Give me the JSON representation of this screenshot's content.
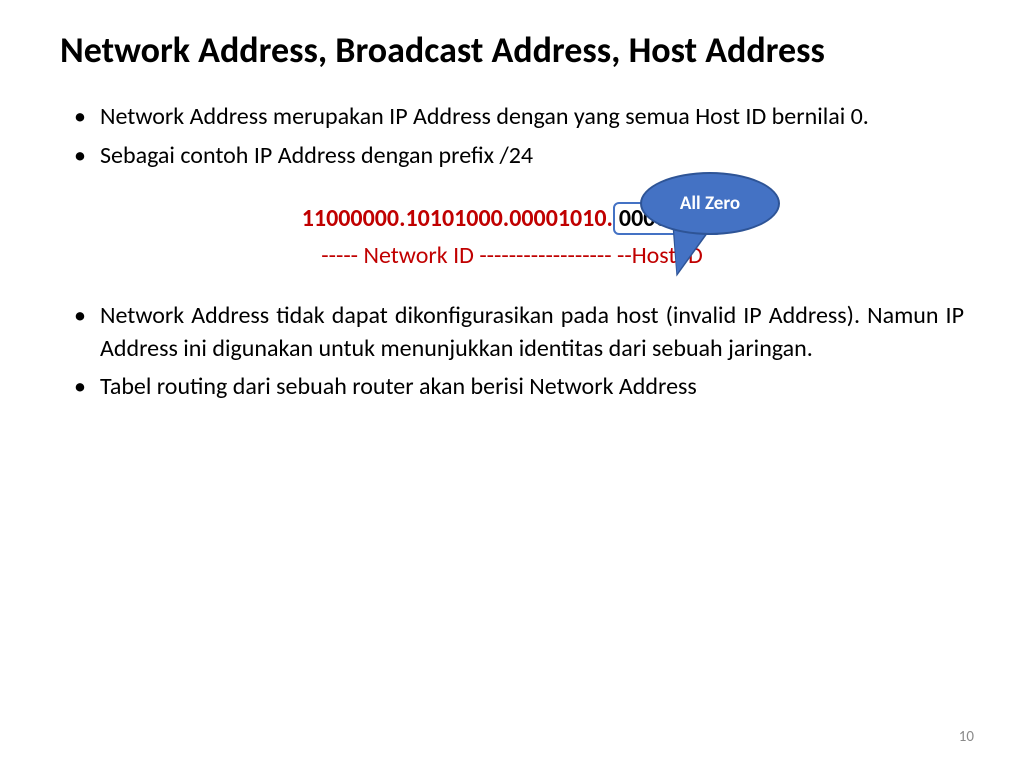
{
  "title": "Network Address, Broadcast Address, Host Address",
  "bullets": {
    "b1": "Network Address merupakan IP Address dengan yang semua Host ID bernilai 0.",
    "b2": "Sebagai contoh IP Address dengan prefix /24",
    "b3": "Network Address tidak dapat dikonfigurasikan pada host (invalid IP Address). Namun IP Address ini digunakan untuk menunjukkan identitas dari sebuah jaringan.",
    "b4": "Tabel routing dari sebuah router akan berisi Network Address"
  },
  "binary": {
    "network_part": "11000000.10101000.00001010.",
    "host_part": "00000000"
  },
  "id_label": "----- Network ID  ------------------ --Host ID",
  "callout_label": "All Zero",
  "page_number": "10"
}
